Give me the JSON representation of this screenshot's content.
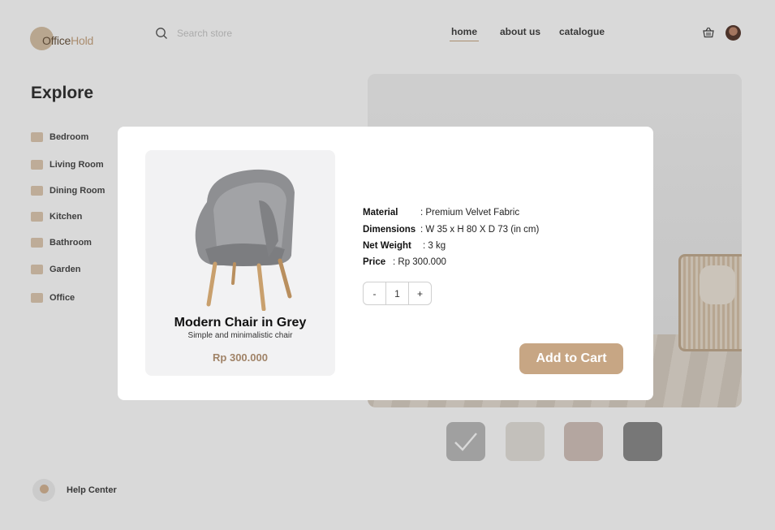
{
  "brand": {
    "part1": "Office",
    "part2": "Hold"
  },
  "search": {
    "placeholder": "Search store"
  },
  "nav": {
    "home": "home",
    "about": "about us",
    "catalogue": "catalogue"
  },
  "explore": {
    "title": "Explore",
    "categories": [
      {
        "label": "Bedroom",
        "icon": "bed-icon"
      },
      {
        "label": "Living Room",
        "icon": "sofa-icon"
      },
      {
        "label": "Dining Room",
        "icon": "cutlery-icon"
      },
      {
        "label": "Kitchen",
        "icon": "fridge-icon"
      },
      {
        "label": "Bathroom",
        "icon": "bathtub-icon"
      },
      {
        "label": "Garden",
        "icon": "plant-icon"
      },
      {
        "label": "Office",
        "icon": "desk-icon"
      }
    ]
  },
  "help": {
    "label": "Help Center"
  },
  "swatches": {
    "colors": [
      "#bdbdbd",
      "#e6e2dc",
      "#d4c3bd",
      "#8c8c8c"
    ],
    "selected_index": 0
  },
  "product": {
    "name": "Modern Chair in Grey",
    "subtitle": "Simple and minimalistic chair",
    "price": "Rp 300.000",
    "specs": {
      "material_label": "Material",
      "material_value": ": Premium Velvet Fabric",
      "dimensions_label": "Dimensions",
      "dimensions_value": ": W 35 x H 80 X D 73 (in cm)",
      "weight_label": "Net Weight",
      "weight_value": ": 3 kg",
      "price_label": "Price",
      "price_value": ": Rp 300.000"
    }
  },
  "quantity": {
    "minus": "-",
    "value": "1",
    "plus": "+"
  },
  "actions": {
    "add_to_cart": "Add to Cart"
  },
  "colors": {
    "accent": "#c7a684",
    "price_text": "#a08367",
    "overlay": "rgba(0,0,0,0.15)"
  }
}
